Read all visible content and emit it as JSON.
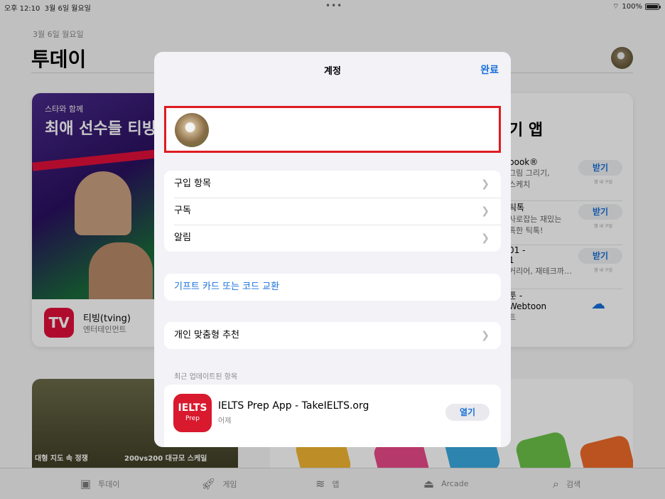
{
  "status_bar": {
    "time": "오후 12:10",
    "date": "3월 6일 월요일",
    "dots": "•••",
    "battery": "100%"
  },
  "today": {
    "date": "3월 6일 월요일",
    "title": "투데이",
    "featured": {
      "subtitle": "스타와 함께",
      "headline": "최애 선수들 티빙",
      "app_name": "티빙(tving)",
      "app_category": "엔터테인먼트",
      "icon_text": "TV"
    },
    "list_card": {
      "title": "기 앱",
      "rows": [
        {
          "line1": "book®",
          "line2": "그림 그리기,",
          "line3": "스케치",
          "button": "받기",
          "iap": "앱 내 구입"
        },
        {
          "line1": "틱톡",
          "line2": "사로잡는 재밌는",
          "line3": "특한 틱톡!",
          "button": "받기",
          "iap": "앱 내 구입"
        },
        {
          "line1": "01 -",
          "line2": "1",
          "line3": "커리어, 재테크까…",
          "button": "받기",
          "iap": "앱 내 구입"
        },
        {
          "line1": "툰 -",
          "line2": "Webtoon",
          "line3": "트"
        }
      ]
    },
    "bottom_left_captions": [
      "대형 지도 속 정쟁",
      "200vs200 대규모 스케일"
    ]
  },
  "tab_bar": [
    {
      "label": "투데이",
      "icon": "today-icon"
    },
    {
      "label": "게임",
      "icon": "rocket-icon"
    },
    {
      "label": "앱",
      "icon": "stack-icon"
    },
    {
      "label": "Arcade",
      "icon": "joystick-icon"
    },
    {
      "label": "검색",
      "icon": "search-icon"
    }
  ],
  "account_sheet": {
    "title": "계정",
    "done": "완료",
    "menu": [
      {
        "label": "구입 항목"
      },
      {
        "label": "구독"
      },
      {
        "label": "알림"
      }
    ],
    "gift_link": "기프트 카드 또는 코드 교환",
    "personalized": "개인 맞춤형 추천",
    "recent_updates_label": "최근 업데이트된 항목",
    "recent_app": {
      "name": "IELTS Prep App - TakeIELTS.org",
      "when": "어제",
      "button": "열기",
      "icon_line1": "IELTS",
      "icon_line2": "Prep"
    },
    "highlight_color": "#e01b22",
    "accent_color": "#1670d9"
  }
}
